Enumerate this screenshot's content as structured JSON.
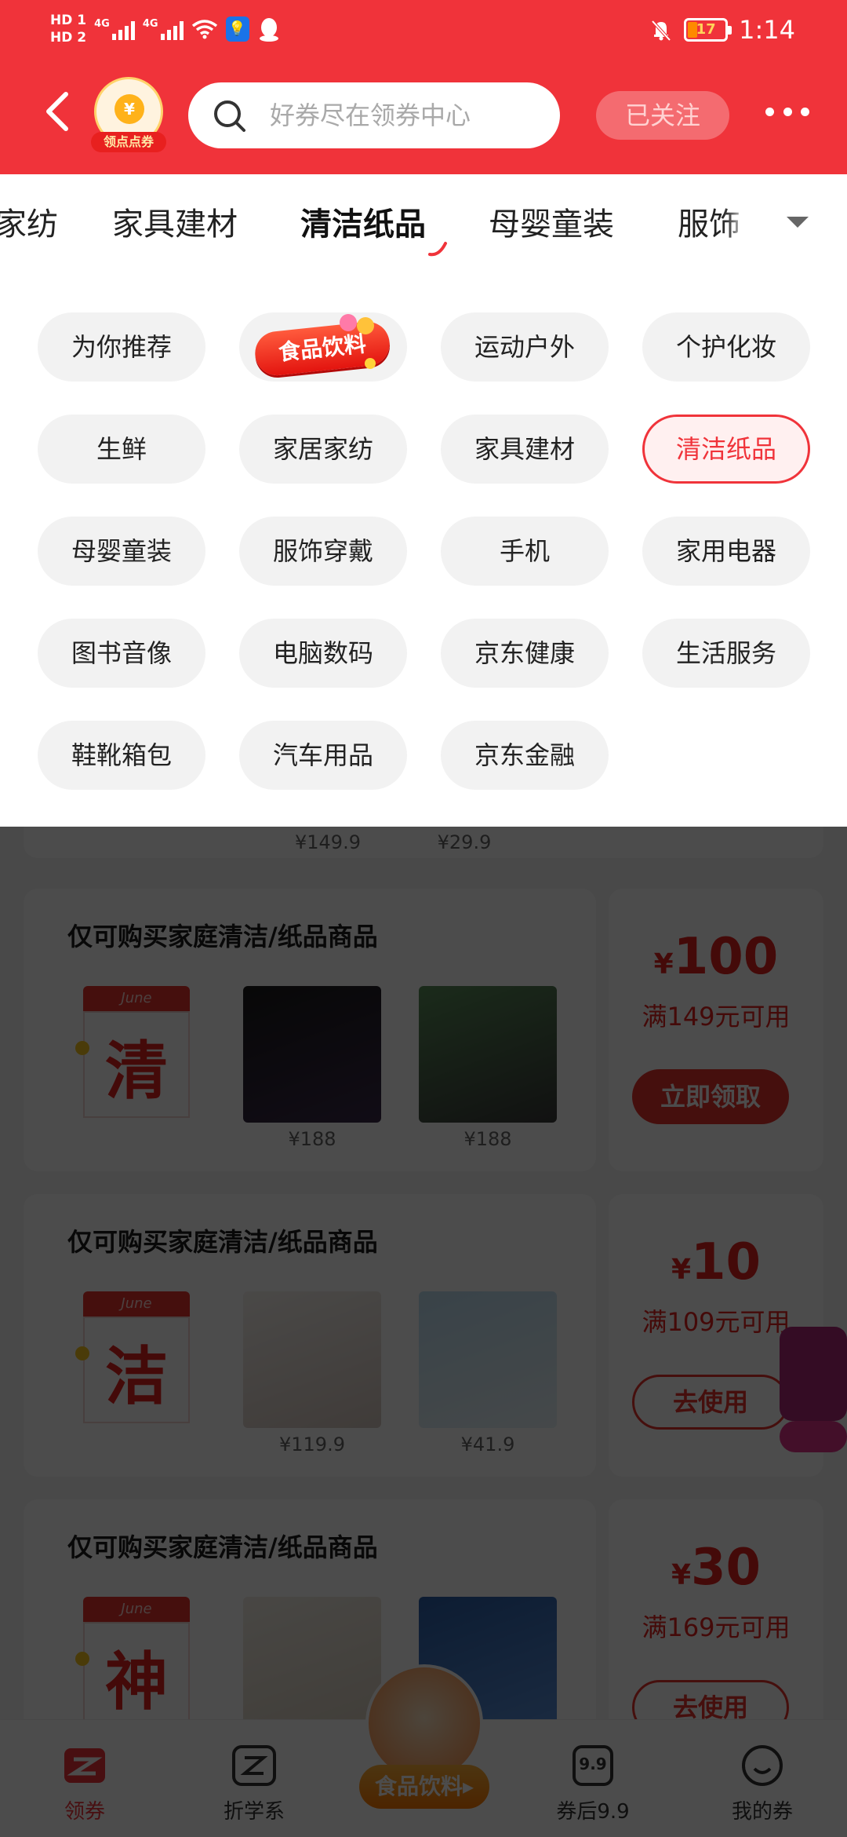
{
  "status_bar": {
    "hd1": "HD 1",
    "hd2": "HD 2",
    "net1": "4G",
    "net2": "4G",
    "battery": "17",
    "time": "1:14"
  },
  "header": {
    "badge_coin": "¥",
    "badge_label": "领点点券",
    "search_placeholder": "好券尽在领券中心",
    "follow_label": "已关注"
  },
  "tabs": [
    "家纺",
    "家具建材",
    "清洁纸品",
    "母婴童装",
    "服饰"
  ],
  "active_tab_index": 2,
  "categories": [
    {
      "label": "为你推荐"
    },
    {
      "label": "食品饮料",
      "badge": true
    },
    {
      "label": "运动户外"
    },
    {
      "label": "个护化妆"
    },
    {
      "label": "生鲜"
    },
    {
      "label": "家居家纺"
    },
    {
      "label": "家具建材"
    },
    {
      "label": "清洁纸品",
      "selected": true
    },
    {
      "label": "母婴童装"
    },
    {
      "label": "服饰穿戴"
    },
    {
      "label": "手机"
    },
    {
      "label": "家用电器"
    },
    {
      "label": "图书音像"
    },
    {
      "label": "电脑数码"
    },
    {
      "label": "京东健康"
    },
    {
      "label": "生活服务"
    },
    {
      "label": "鞋靴箱包"
    },
    {
      "label": "汽车用品"
    },
    {
      "label": "京东金融"
    }
  ],
  "partial_prices": [
    "¥149.9",
    "¥29.9"
  ],
  "coupons": [
    {
      "title": "仅可购买家庭清洁/纸品商品",
      "cal_month": "June",
      "cal_char": "清",
      "prices": [
        "¥188",
        "¥188"
      ],
      "currency": "¥",
      "amount": "100",
      "condition": "满149元可用",
      "button": "立即领取",
      "button_style": "fill"
    },
    {
      "title": "仅可购买家庭清洁/纸品商品",
      "cal_month": "June",
      "cal_char": "洁",
      "prices": [
        "¥119.9",
        "¥41.9"
      ],
      "currency": "¥",
      "amount": "10",
      "condition": "满109元可用",
      "button": "去使用",
      "button_style": "outline"
    },
    {
      "title": "仅可购买家庭清洁/纸品商品",
      "cal_month": "June",
      "cal_char": "神",
      "prices": [],
      "currency": "¥",
      "amount": "30",
      "condition": "满169元可用",
      "button": "去使用",
      "button_style": "outline"
    }
  ],
  "bottom_nav": {
    "items": [
      "领券",
      "折学系",
      "券后9.9",
      "我的券"
    ],
    "center_label": "食品饮料▸",
    "icon_99": "9.9"
  },
  "colors": {
    "brand_red": "#f0333a",
    "accent_red": "#e8322e"
  }
}
